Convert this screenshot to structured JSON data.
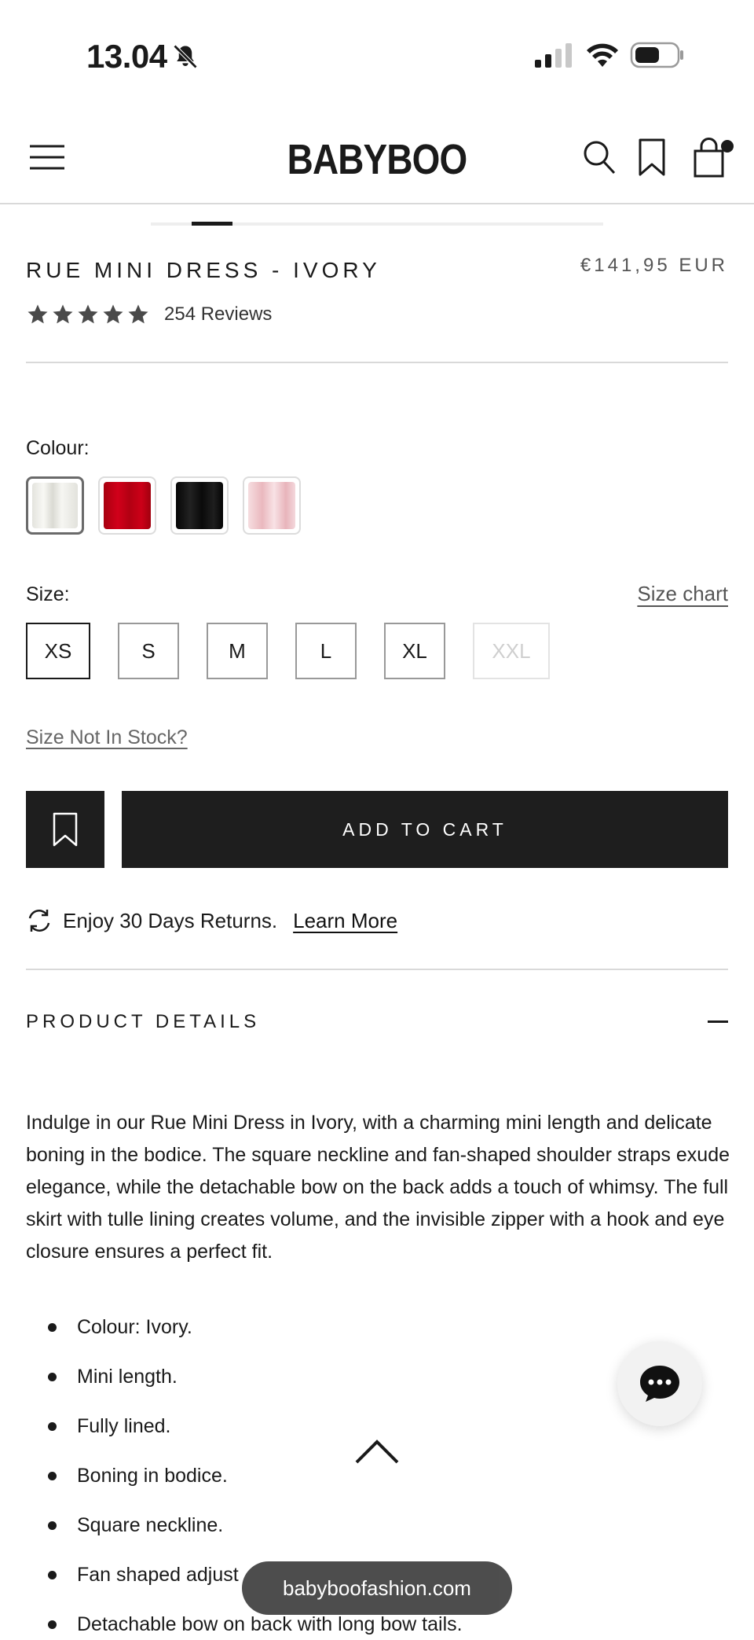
{
  "status_bar": {
    "time": "13.04"
  },
  "header": {
    "brand": "BABYBOO"
  },
  "product": {
    "title": "RUE MINI DRESS - IVORY",
    "price": "€141,95 EUR",
    "rating_stars": 5,
    "reviews": "254 Reviews"
  },
  "colour": {
    "label": "Colour:",
    "swatches": [
      {
        "name": "Ivory",
        "color": "#efefea",
        "selected": true
      },
      {
        "name": "Red",
        "color": "#c40016",
        "selected": false
      },
      {
        "name": "Black",
        "color": "#111111",
        "selected": false
      },
      {
        "name": "Pink",
        "color": "#f3c9cf",
        "selected": false
      }
    ]
  },
  "size": {
    "label": "Size:",
    "chart_link": "Size chart",
    "options": [
      {
        "label": "XS",
        "selected": true,
        "available": true
      },
      {
        "label": "S",
        "selected": false,
        "available": true
      },
      {
        "label": "M",
        "selected": false,
        "available": true
      },
      {
        "label": "L",
        "selected": false,
        "available": true
      },
      {
        "label": "XL",
        "selected": false,
        "available": true
      },
      {
        "label": "XXL",
        "selected": false,
        "available": false
      }
    ],
    "not_in_stock_link": "Size Not In Stock?"
  },
  "actions": {
    "add_to_cart": "ADD TO CART"
  },
  "returns": {
    "text": "Enjoy 30 Days Returns.",
    "link": "Learn More"
  },
  "details": {
    "heading": "PRODUCT DETAILS",
    "description": "Indulge in our Rue Mini Dress in Ivory, with a charming mini length and delicate boning in the bodice. The square neckline and fan-shaped shoulder straps exude elegance, while the detachable bow on the back adds a touch of whimsy. The full skirt with tulle lining creates volume, and the invisible zipper with a hook and eye closure ensures a perfect fit.",
    "features": [
      "Colour: Ivory.",
      "Mini length.",
      "Fully lined.",
      "Boning in bodice.",
      "Square neckline.",
      "Fan shaped adjust",
      "Detachable bow on back with long bow tails."
    ]
  },
  "browser": {
    "url": "babyboofashion.com"
  }
}
